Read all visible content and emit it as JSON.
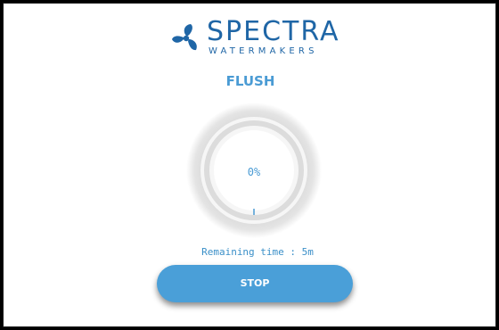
{
  "brand": {
    "name": "SPECTRA",
    "tagline": "WATERMAKERS",
    "color": "#1f66a6"
  },
  "mode": {
    "title": "FLUSH"
  },
  "progress": {
    "percent_label": "0%",
    "value": 0
  },
  "status": {
    "remaining_text": "Remaining time : 5m"
  },
  "actions": {
    "stop_label": "STOP"
  },
  "colors": {
    "accent": "#4a9fd8",
    "text_accent": "#4a9bd4"
  }
}
